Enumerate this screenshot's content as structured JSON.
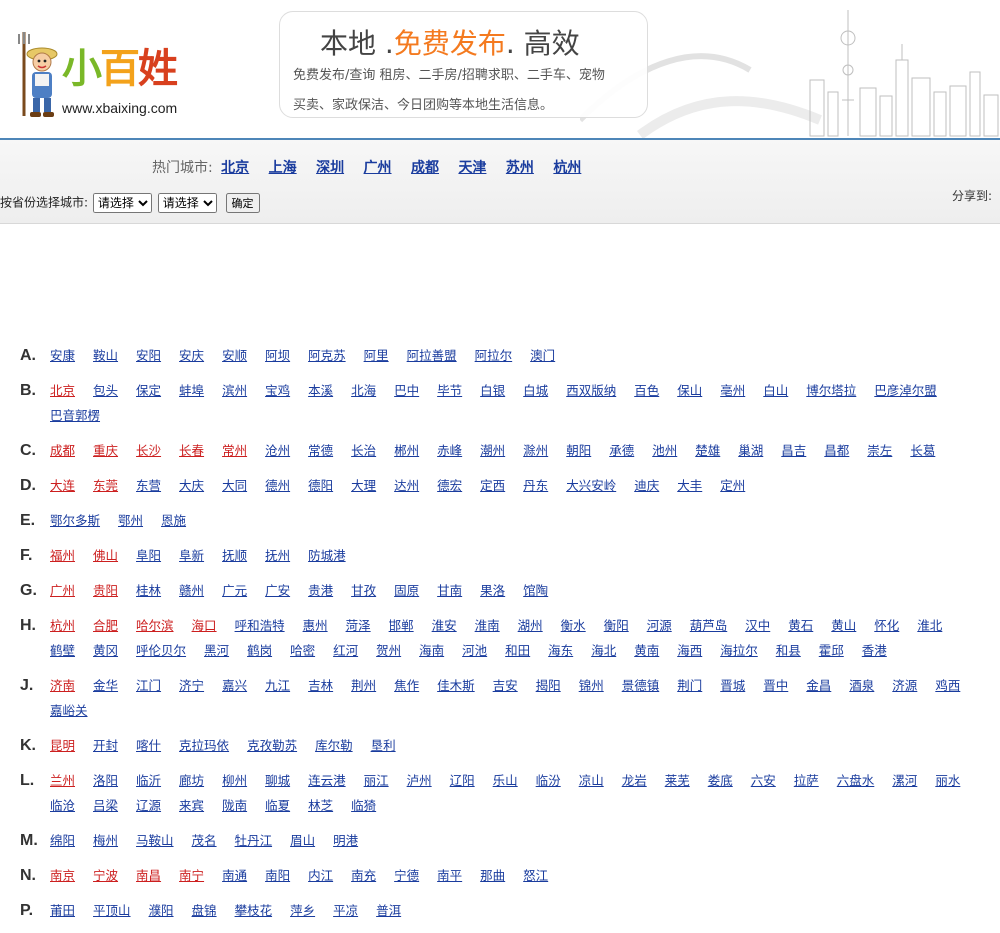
{
  "header": {
    "logo_text": [
      "小",
      "百",
      "姓"
    ],
    "logo_url": "www.xbaixing.com",
    "slogan": {
      "part1": "本地 .",
      "highlight": "免费发布",
      "part2": ". 高效"
    },
    "slogan_line1": "免费发布/查询 租房、二手房/招聘求职、二手车、宠物",
    "slogan_line2": "买卖、家政保洁、今日团购等本地生活信息。"
  },
  "hot_cities": {
    "label": "热门城市:",
    "items": [
      "北京",
      "上海",
      "深圳",
      "广州",
      "成都",
      "天津",
      "苏州",
      "杭州"
    ]
  },
  "province_selector": {
    "label": "按省份选择城市:",
    "select1": "请选择",
    "select2": "请选择",
    "confirm": "确定"
  },
  "share_label": "分享到:",
  "city_groups": [
    {
      "letter": "A.",
      "cities": [
        {
          "name": "安康"
        },
        {
          "name": "鞍山"
        },
        {
          "name": "安阳"
        },
        {
          "name": "安庆"
        },
        {
          "name": "安顺"
        },
        {
          "name": "阿坝"
        },
        {
          "name": "阿克苏"
        },
        {
          "name": "阿里"
        },
        {
          "name": "阿拉善盟"
        },
        {
          "name": "阿拉尔"
        },
        {
          "name": "澳门"
        }
      ]
    },
    {
      "letter": "B.",
      "cities": [
        {
          "name": "北京",
          "hot": true
        },
        {
          "name": "包头"
        },
        {
          "name": "保定"
        },
        {
          "name": "蚌埠"
        },
        {
          "name": "滨州"
        },
        {
          "name": "宝鸡"
        },
        {
          "name": "本溪"
        },
        {
          "name": "北海"
        },
        {
          "name": "巴中"
        },
        {
          "name": "毕节"
        },
        {
          "name": "白银"
        },
        {
          "name": "白城"
        },
        {
          "name": "西双版纳"
        },
        {
          "name": "百色"
        },
        {
          "name": "保山"
        },
        {
          "name": "亳州"
        },
        {
          "name": "白山"
        },
        {
          "name": "博尔塔拉"
        },
        {
          "name": "巴彦淖尔盟"
        },
        {
          "name": "巴音郭楞"
        }
      ]
    },
    {
      "letter": "C.",
      "cities": [
        {
          "name": "成都",
          "hot": true
        },
        {
          "name": "重庆",
          "hot": true
        },
        {
          "name": "长沙",
          "hot": true
        },
        {
          "name": "长春",
          "hot": true
        },
        {
          "name": "常州",
          "hot": true
        },
        {
          "name": "沧州"
        },
        {
          "name": "常德"
        },
        {
          "name": "长治"
        },
        {
          "name": "郴州"
        },
        {
          "name": "赤峰"
        },
        {
          "name": "潮州"
        },
        {
          "name": "滁州"
        },
        {
          "name": "朝阳"
        },
        {
          "name": "承德"
        },
        {
          "name": "池州"
        },
        {
          "name": "楚雄"
        },
        {
          "name": "巢湖"
        },
        {
          "name": "昌吉"
        },
        {
          "name": "昌都"
        },
        {
          "name": "崇左"
        },
        {
          "name": "长葛"
        }
      ]
    },
    {
      "letter": "D.",
      "cities": [
        {
          "name": "大连",
          "hot": true
        },
        {
          "name": "东莞",
          "hot": true
        },
        {
          "name": "东营"
        },
        {
          "name": "大庆"
        },
        {
          "name": "大同"
        },
        {
          "name": "德州"
        },
        {
          "name": "德阳"
        },
        {
          "name": "大理"
        },
        {
          "name": "达州"
        },
        {
          "name": "德宏"
        },
        {
          "name": "定西"
        },
        {
          "name": "丹东"
        },
        {
          "name": "大兴安岭"
        },
        {
          "name": "迪庆"
        },
        {
          "name": "大丰"
        },
        {
          "name": "定州"
        }
      ]
    },
    {
      "letter": "E.",
      "cities": [
        {
          "name": "鄂尔多斯"
        },
        {
          "name": "鄂州"
        },
        {
          "name": "恩施"
        }
      ]
    },
    {
      "letter": "F.",
      "cities": [
        {
          "name": "福州",
          "hot": true
        },
        {
          "name": "佛山",
          "hot": true
        },
        {
          "name": "阜阳"
        },
        {
          "name": "阜新"
        },
        {
          "name": "抚顺"
        },
        {
          "name": "抚州"
        },
        {
          "name": "防城港"
        }
      ]
    },
    {
      "letter": "G.",
      "cities": [
        {
          "name": "广州",
          "hot": true
        },
        {
          "name": "贵阳",
          "hot": true
        },
        {
          "name": "桂林"
        },
        {
          "name": "赣州"
        },
        {
          "name": "广元"
        },
        {
          "name": "广安"
        },
        {
          "name": "贵港"
        },
        {
          "name": "甘孜"
        },
        {
          "name": "固原"
        },
        {
          "name": "甘南"
        },
        {
          "name": "果洛"
        },
        {
          "name": "馆陶"
        }
      ]
    },
    {
      "letter": "H.",
      "cities": [
        {
          "name": "杭州",
          "hot": true
        },
        {
          "name": "合肥",
          "hot": true
        },
        {
          "name": "哈尔滨",
          "hot": true
        },
        {
          "name": "海口",
          "hot": true
        },
        {
          "name": "呼和浩特"
        },
        {
          "name": "惠州"
        },
        {
          "name": "菏泽"
        },
        {
          "name": "邯郸"
        },
        {
          "name": "淮安"
        },
        {
          "name": "淮南"
        },
        {
          "name": "湖州"
        },
        {
          "name": "衡水"
        },
        {
          "name": "衡阳"
        },
        {
          "name": "河源"
        },
        {
          "name": "葫芦岛"
        },
        {
          "name": "汉中"
        },
        {
          "name": "黄石"
        },
        {
          "name": "黄山"
        },
        {
          "name": "怀化"
        },
        {
          "name": "淮北"
        },
        {
          "name": "鹤壁"
        },
        {
          "name": "黄冈"
        },
        {
          "name": "呼伦贝尔"
        },
        {
          "name": "黑河"
        },
        {
          "name": "鹤岗"
        },
        {
          "name": "哈密"
        },
        {
          "name": "红河"
        },
        {
          "name": "贺州"
        },
        {
          "name": "海南"
        },
        {
          "name": "河池"
        },
        {
          "name": "和田"
        },
        {
          "name": "海东"
        },
        {
          "name": "海北"
        },
        {
          "name": "黄南"
        },
        {
          "name": "海西"
        },
        {
          "name": "海拉尔"
        },
        {
          "name": "和县"
        },
        {
          "name": "霍邱"
        },
        {
          "name": "香港"
        }
      ]
    },
    {
      "letter": "J.",
      "cities": [
        {
          "name": "济南",
          "hot": true
        },
        {
          "name": "金华"
        },
        {
          "name": "江门"
        },
        {
          "name": "济宁"
        },
        {
          "name": "嘉兴"
        },
        {
          "name": "九江"
        },
        {
          "name": "吉林"
        },
        {
          "name": "荆州"
        },
        {
          "name": "焦作"
        },
        {
          "name": "佳木斯"
        },
        {
          "name": "吉安"
        },
        {
          "name": "揭阳"
        },
        {
          "name": "锦州"
        },
        {
          "name": "景德镇"
        },
        {
          "name": "荆门"
        },
        {
          "name": "晋城"
        },
        {
          "name": "晋中"
        },
        {
          "name": "金昌"
        },
        {
          "name": "酒泉"
        },
        {
          "name": "济源"
        },
        {
          "name": "鸡西"
        },
        {
          "name": "嘉峪关"
        }
      ]
    },
    {
      "letter": "K.",
      "cities": [
        {
          "name": "昆明",
          "hot": true
        },
        {
          "name": "开封"
        },
        {
          "name": "喀什"
        },
        {
          "name": "克拉玛依"
        },
        {
          "name": "克孜勒苏"
        },
        {
          "name": "库尔勒"
        },
        {
          "name": "垦利"
        }
      ]
    },
    {
      "letter": "L.",
      "cities": [
        {
          "name": "兰州",
          "hot": true
        },
        {
          "name": "洛阳"
        },
        {
          "name": "临沂"
        },
        {
          "name": "廊坊"
        },
        {
          "name": "柳州"
        },
        {
          "name": "聊城"
        },
        {
          "name": "连云港"
        },
        {
          "name": "丽江"
        },
        {
          "name": "泸州"
        },
        {
          "name": "辽阳"
        },
        {
          "name": "乐山"
        },
        {
          "name": "临汾"
        },
        {
          "name": "凉山"
        },
        {
          "name": "龙岩"
        },
        {
          "name": "莱芜"
        },
        {
          "name": "娄底"
        },
        {
          "name": "六安"
        },
        {
          "name": "拉萨"
        },
        {
          "name": "六盘水"
        },
        {
          "name": "漯河"
        },
        {
          "name": "丽水"
        },
        {
          "name": "临沧"
        },
        {
          "name": "吕梁"
        },
        {
          "name": "辽源"
        },
        {
          "name": "来宾"
        },
        {
          "name": "陇南"
        },
        {
          "name": "临夏"
        },
        {
          "name": "林芝"
        },
        {
          "name": "临猗"
        }
      ]
    },
    {
      "letter": "M.",
      "cities": [
        {
          "name": "绵阳"
        },
        {
          "name": "梅州"
        },
        {
          "name": "马鞍山"
        },
        {
          "name": "茂名"
        },
        {
          "name": "牡丹江"
        },
        {
          "name": "眉山"
        },
        {
          "name": "明港"
        }
      ]
    },
    {
      "letter": "N.",
      "cities": [
        {
          "name": "南京",
          "hot": true
        },
        {
          "name": "宁波",
          "hot": true
        },
        {
          "name": "南昌",
          "hot": true
        },
        {
          "name": "南宁",
          "hot": true
        },
        {
          "name": "南通"
        },
        {
          "name": "南阳"
        },
        {
          "name": "内江"
        },
        {
          "name": "南充"
        },
        {
          "name": "宁德"
        },
        {
          "name": "南平"
        },
        {
          "name": "那曲"
        },
        {
          "name": "怒江"
        }
      ]
    },
    {
      "letter": "P.",
      "cities": [
        {
          "name": "莆田"
        },
        {
          "name": "平顶山"
        },
        {
          "name": "濮阳"
        },
        {
          "name": "盘锦"
        },
        {
          "name": "攀枝花"
        },
        {
          "name": "萍乡"
        },
        {
          "name": "平凉"
        },
        {
          "name": "普洱"
        }
      ]
    }
  ]
}
